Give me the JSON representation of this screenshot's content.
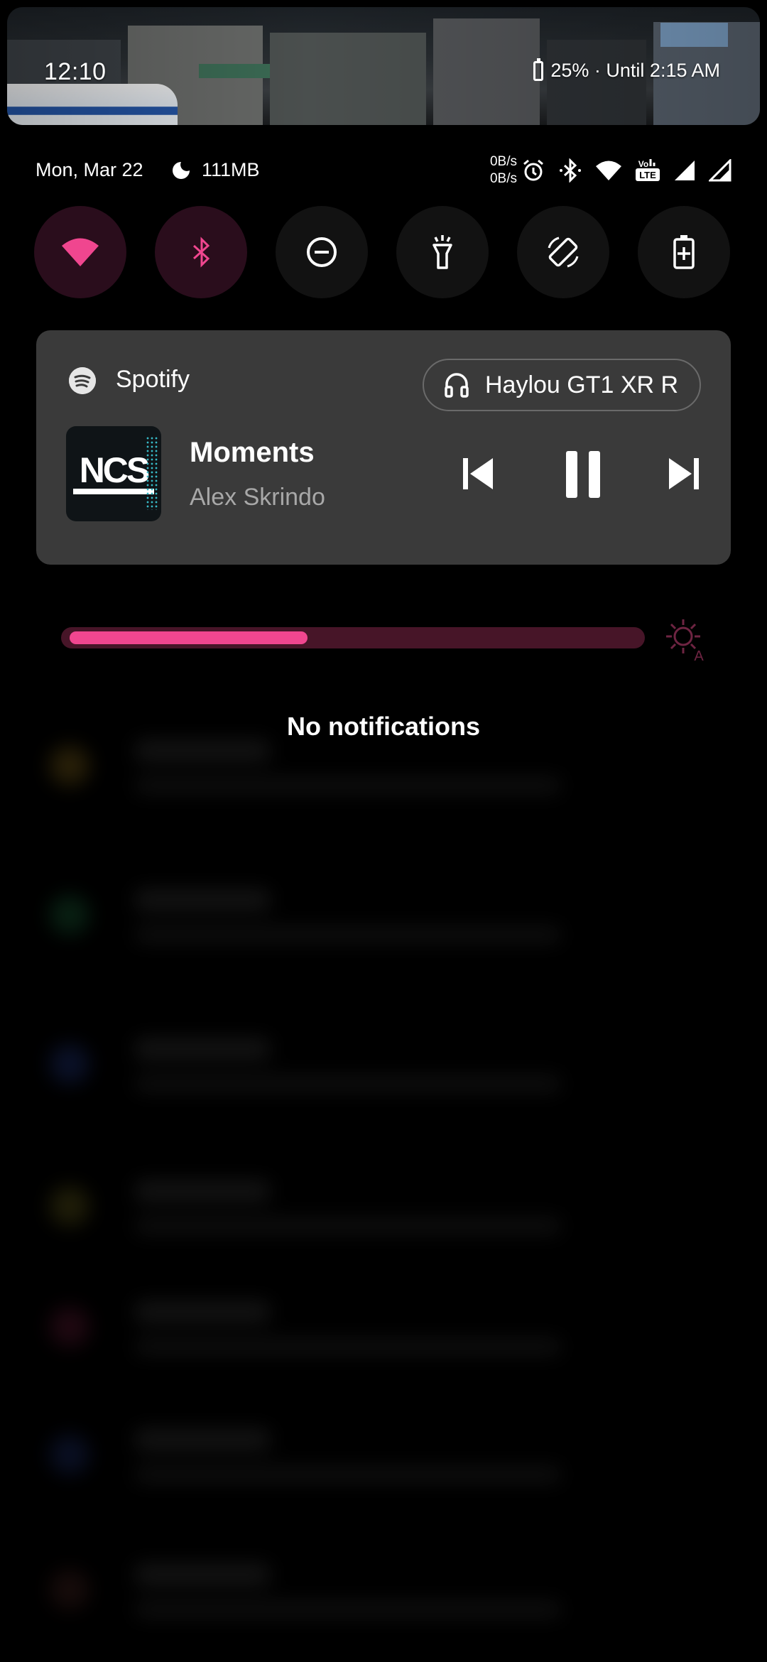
{
  "header": {
    "time": "12:10",
    "battery_text": "25% · Until 2:15 AM"
  },
  "status": {
    "date": "Mon, Mar 22",
    "memory": "111MB",
    "net_up": "0B/s",
    "net_down": "0B/s",
    "icons": [
      "alarm-icon",
      "bluetooth-icon",
      "wifi-icon",
      "volte-icon",
      "signal-icon",
      "signal-icon"
    ]
  },
  "toggles": [
    {
      "name": "wifi",
      "icon": "wifi-icon",
      "active": true
    },
    {
      "name": "bluetooth",
      "icon": "bluetooth-icon",
      "active": true
    },
    {
      "name": "do-not-disturb",
      "icon": "dnd-icon",
      "active": false
    },
    {
      "name": "flashlight",
      "icon": "flashlight-icon",
      "active": false
    },
    {
      "name": "auto-rotate",
      "icon": "rotate-icon",
      "active": false
    },
    {
      "name": "battery-saver",
      "icon": "battery-saver-icon",
      "active": false
    }
  ],
  "media": {
    "app": "Spotify",
    "device": "Haylou GT1 XR R",
    "album_text": "NCS",
    "title": "Moments",
    "artist": "Alex Skrindo"
  },
  "brightness": {
    "level": 0.42
  },
  "notifications": {
    "empty_text": "No notifications"
  },
  "colors": {
    "accent": "#f0468f",
    "card": "#3a3a3a",
    "background": "#000000"
  }
}
